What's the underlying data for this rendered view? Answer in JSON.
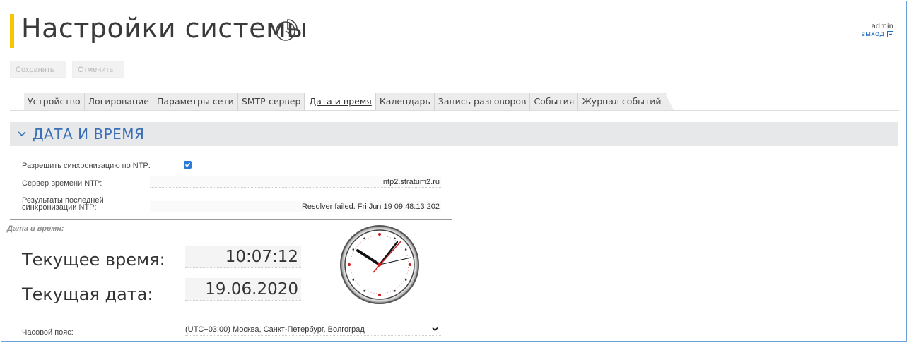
{
  "header": {
    "title": "Настройки системы",
    "title_icon": "pie-chart-icon",
    "user": "admin",
    "logout_label": "выход"
  },
  "toolbar": {
    "save_label": "Сохранить",
    "cancel_label": "Отменить"
  },
  "tabs": [
    {
      "label": "Устройство",
      "active": false
    },
    {
      "label": "Логирование",
      "active": false
    },
    {
      "label": "Параметры сети",
      "active": false
    },
    {
      "label": "SMTP-сервер",
      "active": false
    },
    {
      "label": "Дата и время",
      "active": true
    },
    {
      "label": "Календарь",
      "active": false
    },
    {
      "label": "Запись разговоров",
      "active": false
    },
    {
      "label": "События",
      "active": false
    },
    {
      "label": "Журнал событий",
      "active": false
    }
  ],
  "section": {
    "title": "ДАТА И ВРЕМЯ",
    "ntp_sync_label": "Разрешить синхронизацию по NTP:",
    "ntp_sync_checked": true,
    "ntp_server_label": "Сервер времени NTP:",
    "ntp_server_value": "ntp2.stratum2.ru",
    "ntp_result_label_line1": "Результаты последней",
    "ntp_result_label_line2": "синхронизации NTP:",
    "ntp_result_value": "Resolver failed. Fri Jun 19 09:48:13 202",
    "datetime_subtitle": "Дата и время:",
    "current_time_label": "Текущее время:",
    "current_time_value": "10:07:12",
    "current_date_label": "Текущая дата:",
    "current_date_value": "19.06.2020",
    "timezone_label": "Часовой пояс:",
    "timezone_value": "(UTC+03:00) Москва, Санкт-Петербург, Волгоград"
  },
  "colors": {
    "accent_yellow": "#f7c600",
    "section_title_blue": "#3b6fb6",
    "link_blue": "#1e6bbf",
    "checkbox_blue": "#2a7ad8",
    "clock_second_hand": "#cc1e1e"
  }
}
